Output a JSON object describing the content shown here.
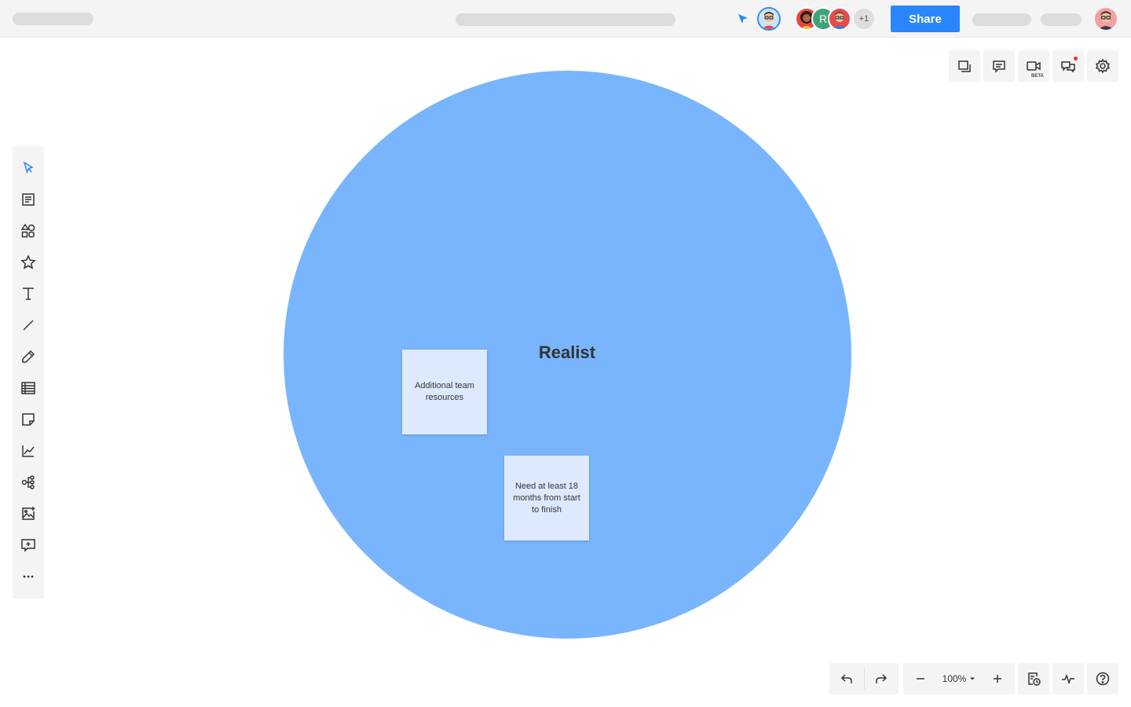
{
  "topbar": {
    "collaborator_initial": "R",
    "more_collaborators": "+1",
    "share_label": "Share"
  },
  "canvas": {
    "circle_title": "Realist",
    "circle_color": "#78b5fc",
    "sticky_color": "#ddeafe",
    "stickies": [
      {
        "text": "Additional team resources"
      },
      {
        "text": "Need at least 18 months from start to finish"
      }
    ]
  },
  "right_tools": {
    "video_badge": "BETA",
    "icons": [
      "layers-icon",
      "comment-icon",
      "video-icon",
      "chat-icon",
      "gear-icon"
    ]
  },
  "left_tools": {
    "icons": [
      "select-icon",
      "document-icon",
      "shapes-icon",
      "star-icon",
      "text-icon",
      "line-icon",
      "pen-icon",
      "table-icon",
      "sticky-note-icon",
      "chart-icon",
      "mindmap-icon",
      "image-icon",
      "add-comment-icon",
      "more-icon"
    ]
  },
  "bottom_bar": {
    "zoom_level": "100%"
  },
  "colors": {
    "accent": "#2a86ff",
    "notification": "#e8312f"
  }
}
